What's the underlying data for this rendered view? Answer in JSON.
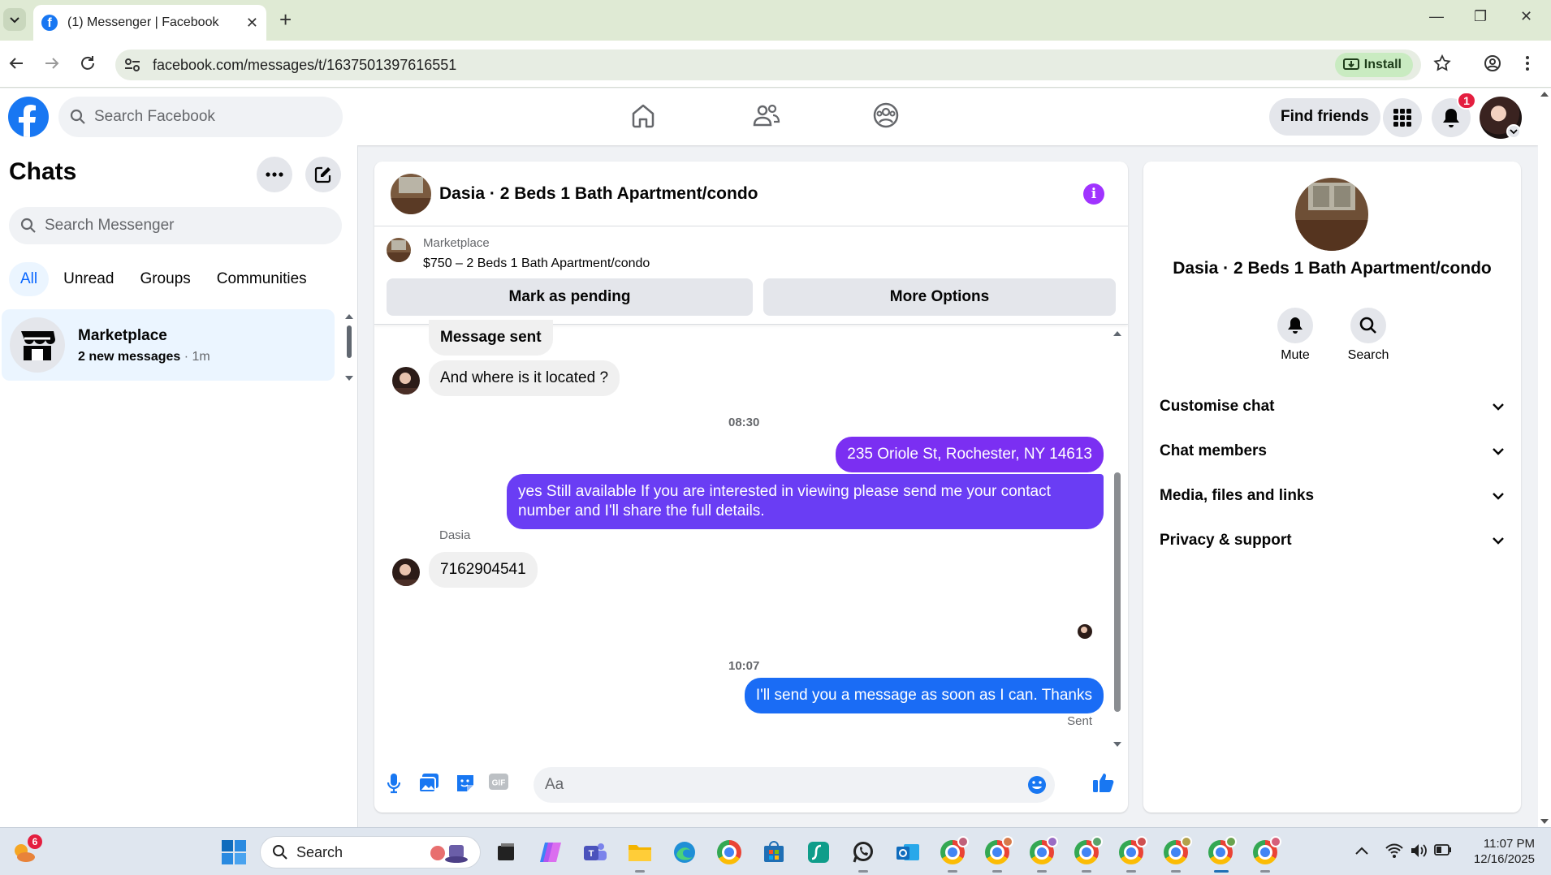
{
  "browser": {
    "tab_title": "(1) Messenger | Facebook",
    "url": "facebook.com/messages/t/1637501397616551",
    "install_label": "Install"
  },
  "fb_header": {
    "search_placeholder": "Search Facebook",
    "find_friends": "Find friends",
    "notification_count": "1"
  },
  "chats": {
    "title": "Chats",
    "search_placeholder": "Search Messenger",
    "filters": [
      "All",
      "Unread",
      "Groups",
      "Communities"
    ],
    "active_filter": "All",
    "items": [
      {
        "name": "Marketplace",
        "preview": "2 new messages",
        "time": " · 1m"
      }
    ]
  },
  "conversation": {
    "title": "Dasia · 2 Beds 1 Bath Apartment/condo",
    "marketplace_label": "Marketplace",
    "listing": "$750 – 2 Beds 1 Bath Apartment/condo",
    "mark_pending": "Mark as pending",
    "more_options": "More Options",
    "messages": [
      {
        "dir": "in",
        "text": "Message sent"
      },
      {
        "dir": "in",
        "text": "And where is it located ?"
      },
      {
        "type": "time",
        "text": "08:30"
      },
      {
        "dir": "out",
        "text": "235 Oriole St, Rochester, NY 14613"
      },
      {
        "dir": "out",
        "text": "yes Still available If you are interested in viewing please send me your contact number and I'll share the full details."
      },
      {
        "type": "sender",
        "text": "Dasia"
      },
      {
        "dir": "in",
        "text": "7162904541"
      },
      {
        "type": "time",
        "text": "10:07"
      },
      {
        "dir": "out",
        "text": "I'll send you a message as soon as I can. Thanks"
      },
      {
        "type": "status",
        "text": "Sent"
      }
    ],
    "composer_placeholder": "Aa"
  },
  "info_panel": {
    "name": "Dasia · 2 Beds 1 Bath Apartment/condo",
    "actions": [
      "Mute",
      "Search"
    ],
    "sections": [
      "Customise chat",
      "Chat members",
      "Media, files and links",
      "Privacy & support"
    ]
  },
  "taskbar": {
    "search_placeholder": "Search",
    "weather_badge": "6",
    "time": "11:07 PM",
    "date": "12/16/2025"
  },
  "colors": {
    "fb_blue": "#1877f2",
    "outgoing_purple": "#7b2ff2",
    "outgoing_blue": "#1a6cf5",
    "active_filter": "#0866ff"
  }
}
